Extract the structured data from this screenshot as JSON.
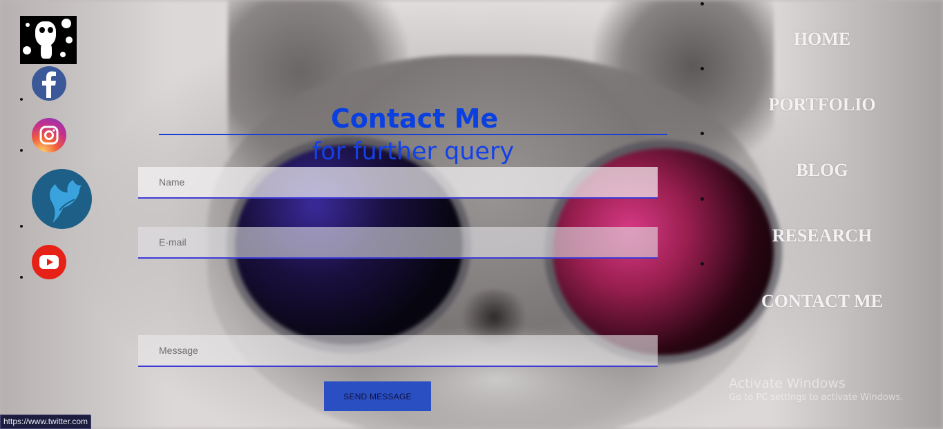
{
  "social": {
    "items": [
      {
        "id": "facebook",
        "icon": "facebook-icon",
        "color": "#3b5998"
      },
      {
        "id": "instagram",
        "icon": "instagram-icon",
        "color": "#c13584"
      },
      {
        "id": "twitter",
        "icon": "twitter-bird-icon",
        "color": "#1e8ad6"
      },
      {
        "id": "youtube",
        "icon": "youtube-icon",
        "color": "#e62117"
      }
    ]
  },
  "heading": {
    "title": "Contact Me",
    "subtitle": "for further query"
  },
  "form": {
    "name_placeholder": "Name",
    "email_placeholder": "E-mail",
    "message_placeholder": "Message",
    "send_label": "SEND MESSAGE"
  },
  "nav": {
    "items": [
      {
        "label": "HOME"
      },
      {
        "label": "PORTFOLIO"
      },
      {
        "label": "BLOG"
      },
      {
        "label": "RESEARCH"
      },
      {
        "label": "CONTACT ME"
      }
    ]
  },
  "watermark": {
    "title": "Activate Windows",
    "subtitle": "Go to PC settings to activate Windows."
  },
  "status_bar": {
    "url": "https://www.twitter.com"
  },
  "colors": {
    "accent_blue": "#0a3fe0",
    "button_blue": "#2a4fc2",
    "field_underline": "#3d3ad8",
    "nav_text": "#f3f1f2"
  }
}
